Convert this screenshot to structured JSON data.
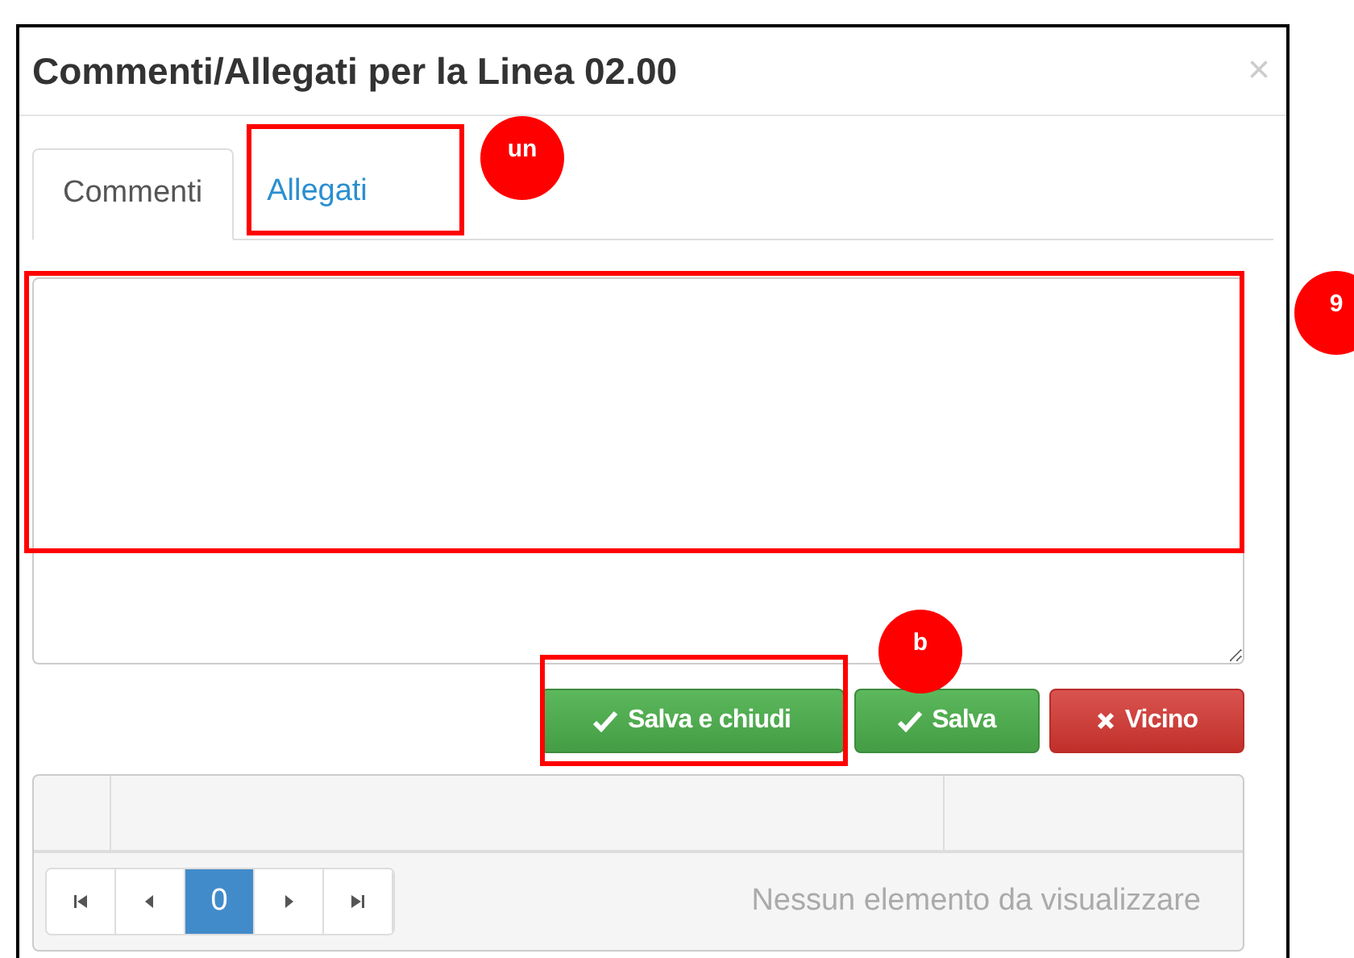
{
  "dialog": {
    "title": "Commenti/Allegati per la Linea 02.00",
    "close": "×"
  },
  "tabs": [
    {
      "label": "Commenti",
      "selected": true
    },
    {
      "label": "Allegati",
      "selected": false
    }
  ],
  "buttons": [
    {
      "label": "Salva e chiudi",
      "kind": "save"
    },
    {
      "label": "Salva",
      "kind": "save"
    },
    {
      "label": "Vicino",
      "kind": "close"
    }
  ],
  "pager": {
    "pages": [
      {
        "label": "0",
        "selected": true
      }
    ],
    "status": "Nessun elemento da visualizzare"
  },
  "annotations": [
    {
      "label": "un"
    },
    {
      "label": "9"
    },
    {
      "label": "b"
    }
  ]
}
